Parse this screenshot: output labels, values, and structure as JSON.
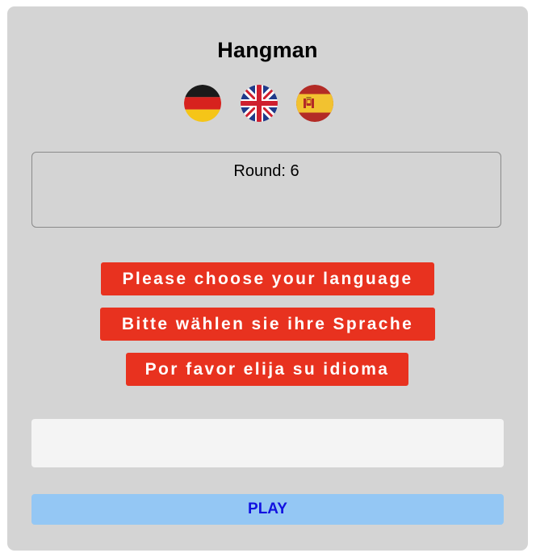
{
  "app": {
    "title": "Hangman"
  },
  "languages": [
    {
      "icon": "german-flag-icon",
      "colors": [
        "#1a1a1a",
        "#d7221e",
        "#f5c518"
      ]
    },
    {
      "icon": "uk-flag-icon",
      "colors": [
        "#1f3a8a",
        "#ffffff",
        "#cf1f2e"
      ]
    },
    {
      "icon": "spanish-flag-icon",
      "colors": [
        "#b32b26",
        "#f2c230",
        "#b32b26"
      ]
    }
  ],
  "round": {
    "text": "Round: 6"
  },
  "messages": [
    "Please choose your language",
    "Bitte wählen sie ihre Sprache",
    "Por favor elija su idioma"
  ],
  "input": {
    "value": "",
    "placeholder": ""
  },
  "play": {
    "label": "PLAY"
  },
  "colors": {
    "panel": "#d4d4d4",
    "message_bg": "#e8321f",
    "message_text": "#ffffff",
    "input_bg": "#f4f4f4",
    "play_bg": "#94c7f4",
    "play_text": "#1212e0"
  }
}
